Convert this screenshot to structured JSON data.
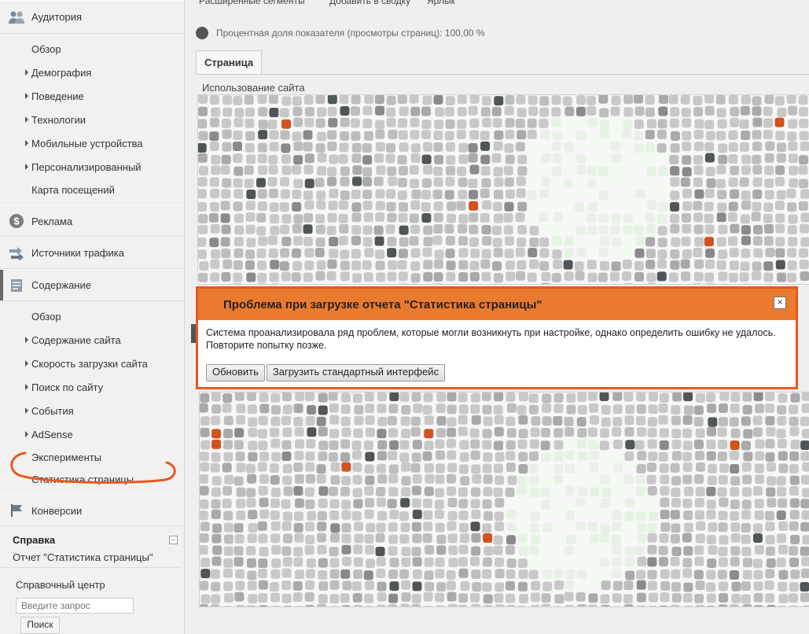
{
  "sidebar": {
    "audience": {
      "label": "Аудитория",
      "items": [
        {
          "label": "Обзор"
        },
        {
          "label": "Демография"
        },
        {
          "label": "Поведение"
        },
        {
          "label": "Технологии"
        },
        {
          "label": "Мобильные устройства"
        },
        {
          "label": "Персонализированный"
        },
        {
          "label": "Карта посещений"
        }
      ]
    },
    "ads": {
      "label": "Реклама"
    },
    "traffic": {
      "label": "Источники трафика"
    },
    "content": {
      "label": "Содержание",
      "items": [
        {
          "label": "Обзор"
        },
        {
          "label": "Содержание сайта"
        },
        {
          "label": "Скорость загрузки сайта"
        },
        {
          "label": "Поиск по сайту"
        },
        {
          "label": "События"
        },
        {
          "label": "AdSense"
        },
        {
          "label": "Эксперименты"
        },
        {
          "label": "Статистика страницы"
        }
      ]
    },
    "conversions": {
      "label": "Конверсии"
    },
    "help": {
      "title": "Справка",
      "collapse": "−",
      "desc": "Отчет \"Статистика страницы\"",
      "center": "Справочный центр",
      "search_placeholder": "Введите запрос",
      "search_button": "Поиск"
    },
    "highlight_color": "#e8581e"
  },
  "main": {
    "topbar": [
      "Расширенные сегменты",
      "Добавить в сводку",
      "Ярлык"
    ],
    "percent_text": "Процентная доля показателя (просмотры страниц): 100,00 %",
    "tab": "Страница",
    "usage_label": "Использование сайта"
  },
  "dialog": {
    "title": "Проблема при загрузке отчета \"Статистика страницы\"",
    "close": "×",
    "message": "Система проанализировала ряд проблем, которые могли возникнуть при настройке, однако определить ошибку не удалось. Повторите попытку позже.",
    "buttons": [
      "Обновить",
      "Загрузить стандартный интерфейс"
    ],
    "accent_color": "#e8581e"
  },
  "icons": {
    "audience": "people-icon",
    "ads": "dollar-icon",
    "traffic": "arrows-icon",
    "content": "document-icon",
    "conversions": "flag-icon"
  }
}
